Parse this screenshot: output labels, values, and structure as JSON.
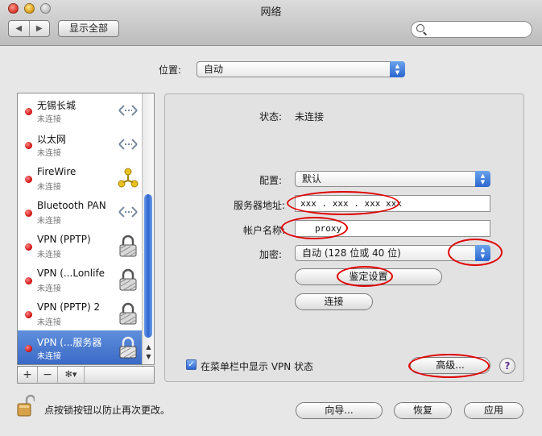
{
  "window": {
    "title": "网络"
  },
  "toolbar": {
    "show_all": "显示全部",
    "back": "◀",
    "forward": "▶"
  },
  "location": {
    "label": "位置:",
    "value": "自动"
  },
  "services": [
    {
      "name": "无锡长城",
      "status": "未连接",
      "icon": "ethernet-arrows-icon"
    },
    {
      "name": "以太网",
      "status": "未连接",
      "icon": "ethernet-arrows-icon"
    },
    {
      "name": "FireWire",
      "status": "未连接",
      "icon": "firewire-icon"
    },
    {
      "name": "Bluetooth PAN",
      "status": "未连接",
      "icon": "ethernet-arrows-icon"
    },
    {
      "name": "VPN (PPTP)",
      "status": "未连接",
      "icon": "vpn-lock-icon"
    },
    {
      "name": "VPN (...Lonlife",
      "status": "未连接",
      "icon": "vpn-lock-icon"
    },
    {
      "name": "VPN (PPTP) 2",
      "status": "未连接",
      "icon": "vpn-lock-icon"
    },
    {
      "name": "VPN (...服务器",
      "status": "未连接",
      "icon": "vpn-lock-icon",
      "selected": true
    }
  ],
  "list_controls": {
    "add": "+",
    "remove": "−",
    "gear": "✻▾"
  },
  "detail": {
    "status_label": "状态:",
    "status_value": "未连接",
    "config_label": "配置:",
    "config_value": "默认",
    "server_label": "服务器地址:",
    "server_value": "xxx . xxx . xxx  xxx",
    "account_label": "帐户名称:",
    "account_value": "proxy",
    "encryption_label": "加密:",
    "encryption_value": "自动 (128 位或 40 位)",
    "auth_button": "鉴定设置",
    "connect_button": "连接",
    "menubar_checkbox": "在菜单栏中显示 VPN 状态",
    "advanced_button": "高级...",
    "help": "?"
  },
  "footer": {
    "lock_text": "点按锁按钮以防止再次更改。",
    "assist_button": "向导...",
    "revert_button": "恢复",
    "apply_button": "应用"
  },
  "annotation_color": "#e10000"
}
